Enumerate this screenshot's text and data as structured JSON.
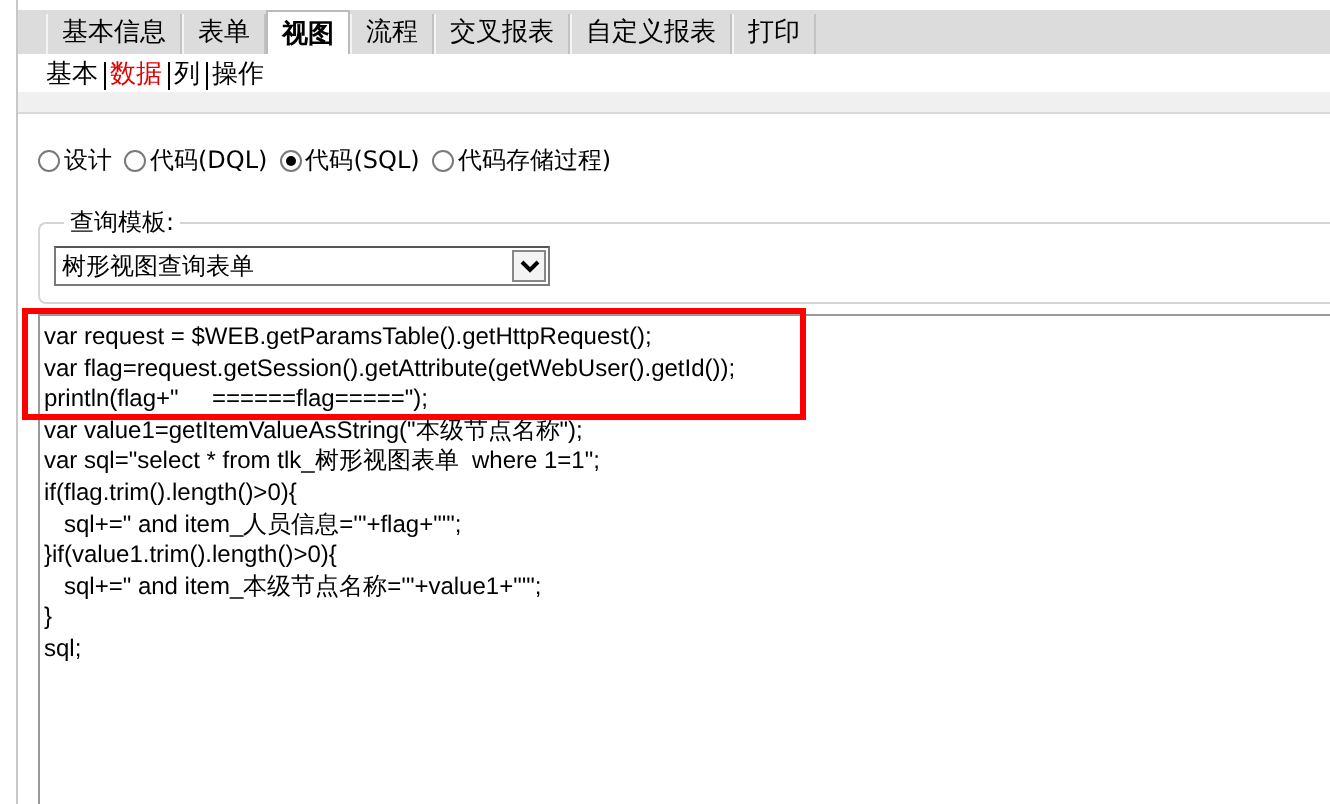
{
  "tabs": [
    {
      "label": "基本信息",
      "selected": false
    },
    {
      "label": "表单",
      "selected": false
    },
    {
      "label": "视图",
      "selected": true
    },
    {
      "label": "流程",
      "selected": false
    },
    {
      "label": "交叉报表",
      "selected": false
    },
    {
      "label": "自定义报表",
      "selected": false
    },
    {
      "label": "打印",
      "selected": false
    }
  ],
  "subtabs": [
    {
      "label": "基本",
      "selected": false
    },
    {
      "label": "数据",
      "selected": true
    },
    {
      "label": "列",
      "selected": false
    },
    {
      "label": "操作",
      "selected": false
    }
  ],
  "modes": [
    {
      "label": "设计",
      "selected": false
    },
    {
      "label": "代码(DQL)",
      "selected": false
    },
    {
      "label": "代码(SQL)",
      "selected": true
    },
    {
      "label": "代码存储过程)",
      "selected": false
    }
  ],
  "query_template": {
    "legend": "查询模板:",
    "value": "树形视图查询表单"
  },
  "code": [
    {
      "text": "var request = $WEB.getParamsTable().getHttpRequest();",
      "highlighted": true
    },
    {
      "text": "var flag=request.getSession().getAttribute(getWebUser().getId());",
      "highlighted": true
    },
    {
      "text": "println(flag+\"     ======flag=====\");",
      "highlighted": true
    },
    {
      "text": "var value1=getItemValueAsString(\"本级节点名称\");",
      "highlighted": false
    },
    {
      "text": "var sql=\"select * from tlk_树形视图表单  where 1=1\";",
      "highlighted": false
    },
    {
      "text": "if(flag.trim().length()>0){",
      "highlighted": false
    },
    {
      "text": "   sql+=\" and item_人员信息='\"+flag+\"'\";",
      "highlighted": false
    },
    {
      "text": "}if(value1.trim().length()>0){",
      "highlighted": false
    },
    {
      "text": "   sql+=\" and item_本级节点名称='\"+value1+\"'\";",
      "highlighted": false
    },
    {
      "text": "}",
      "highlighted": false
    },
    {
      "text": "sql;",
      "highlighted": false
    }
  ]
}
